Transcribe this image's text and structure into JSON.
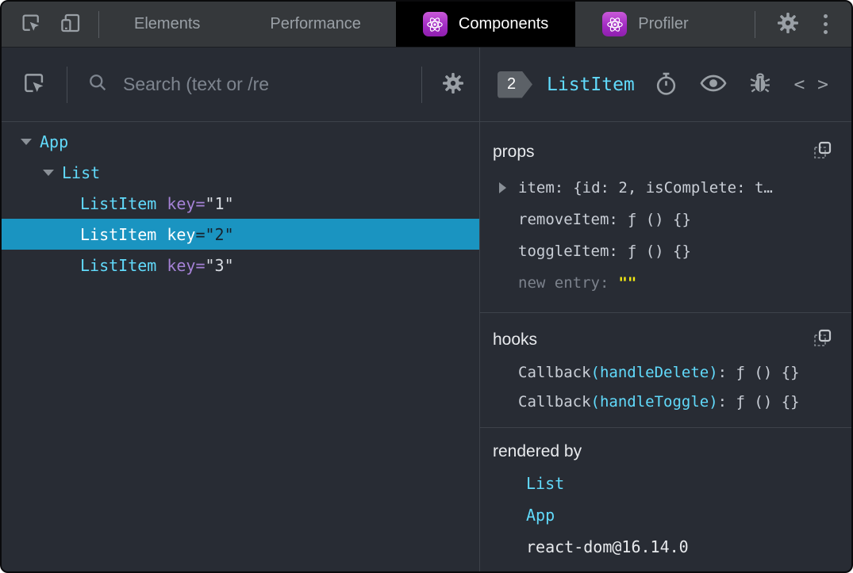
{
  "tabbar": {
    "tabs": [
      {
        "label": "Elements"
      },
      {
        "label": "Performance"
      },
      {
        "label": "Components"
      },
      {
        "label": "Profiler"
      }
    ]
  },
  "icons": {
    "code": "< >"
  },
  "left_panel": {
    "search": {
      "placeholder": "Search (text or /re"
    },
    "tree": [
      {
        "name": "App"
      },
      {
        "name": "List"
      },
      {
        "name": "ListItem",
        "attr": "key",
        "eq": "=",
        "value": "\"1\""
      },
      {
        "name": "ListItem",
        "attr": "key",
        "eq": "=",
        "value": "\"2\""
      },
      {
        "name": "ListItem",
        "attr": "key",
        "eq": "=",
        "value": "\"3\""
      }
    ]
  },
  "right_panel": {
    "header": {
      "badge": "2",
      "component": "ListItem"
    },
    "props": {
      "title": "props",
      "rows": [
        {
          "label": "item:",
          "value": "{id: 2, isComplete: t…"
        },
        {
          "label": "removeItem:",
          "value": "ƒ () {}"
        },
        {
          "label": "toggleItem:",
          "value": "ƒ () {}"
        },
        {
          "label": "new entry:",
          "value": "\"\""
        }
      ]
    },
    "hooks": {
      "title": "hooks",
      "rows": [
        {
          "prefix": "Callback",
          "fn": "(handleDelete)",
          "suffix": ": ƒ () {}"
        },
        {
          "prefix": "Callback",
          "fn": "(handleToggle)",
          "suffix": ": ƒ () {}"
        }
      ]
    },
    "rendered_by": {
      "title": "rendered by",
      "items": [
        {
          "label": "List"
        },
        {
          "label": "App"
        },
        {
          "label": "react-dom@16.14.0"
        }
      ]
    }
  },
  "colors": {
    "component_cyan": "#61dafb",
    "selected_row": "#1a94c1",
    "attr_purple": "#a582d6",
    "string_yellow": "#f1e813",
    "react_purple": "#a32cc4",
    "panel_bg": "#282c34",
    "tabbar_bg": "#35383b"
  }
}
